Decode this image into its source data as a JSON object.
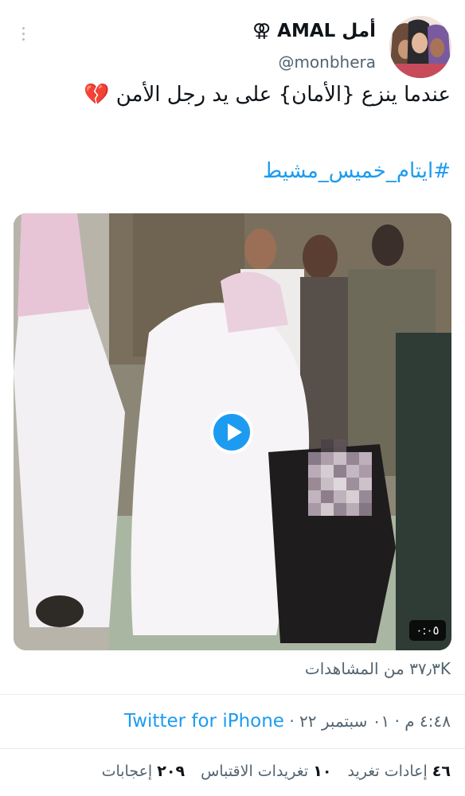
{
  "tweet": {
    "display_name": "أمل AMAL ⚢",
    "handle": "@monbhera",
    "text": "عندما ينزع {الأمان} على يد رجل الأمن 💔",
    "hashtag": "#ايتام_خميس_مشيط",
    "video_duration": "٠:٠٥",
    "views_count": "٣٧٫٣K",
    "views_label": "من المشاهدات",
    "time": "٤:٤٨ م",
    "date": "٠١ سبتمبر ٢٢",
    "separator": "·",
    "source": "Twitter for iPhone",
    "retweets_count": "٤٦",
    "retweets_label": "إعادات تغريد",
    "quotes_count": "١٠",
    "quotes_label": "تغريدات الاقتباس",
    "likes_count": "٢٠٩",
    "likes_label": "إعجابات"
  },
  "icons": {
    "more": "more-vertical-icon",
    "play": "play-icon"
  },
  "colors": {
    "accent": "#1d9bf0",
    "secondary_text": "#536471",
    "primary_text": "#0f1419"
  }
}
